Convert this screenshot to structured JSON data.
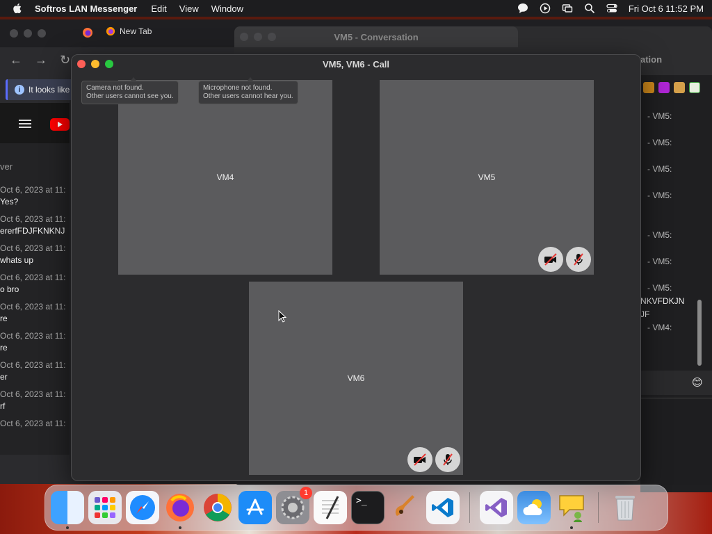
{
  "menubar": {
    "app_name": "Softros LAN Messenger",
    "menus": [
      "Edit",
      "View",
      "Window"
    ],
    "clock": "Fri Oct 6  11:52 PM"
  },
  "browser": {
    "tab_label": "New Tab",
    "info_text": "It looks like",
    "chat_header": "ver",
    "messages": [
      {
        "date": "Oct 6, 2023 at 11:",
        "text": "Yes?"
      },
      {
        "date": "Oct 6, 2023 at 11:",
        "text": "ererfFDJFKNKNJ"
      },
      {
        "date": "Oct 6, 2023 at 11:",
        "text": "whats up"
      },
      {
        "date": "Oct 6, 2023 at 11:",
        "text": "o bro"
      },
      {
        "date": "Oct 6, 2023 at 11:",
        "text": "re"
      },
      {
        "date": "Oct 6, 2023 at 11:",
        "text": "re"
      },
      {
        "date": "Oct 6, 2023 at 11:",
        "text": "er"
      },
      {
        "date": "Oct 6, 2023 at 11:",
        "text": "rf"
      },
      {
        "date": "Oct 6, 2023 at 11:",
        "text": ""
      }
    ]
  },
  "conversation": {
    "title": "VM5 - Conversation",
    "title_right": "ation",
    "log": [
      "- VM5:",
      "- VM5:",
      "- VM5:",
      "- VM5:",
      "- VM5:",
      "- VM5:",
      "- VM5:",
      "NKVFDKJN",
      "JF",
      "- VM4:"
    ],
    "emoji": "😊"
  },
  "call": {
    "title": "VM5, VM6 - Call",
    "camera_notice_line1": "Camera not found.",
    "camera_notice_line2": "Other users cannot see you.",
    "mic_notice_line1": "Microphone not found.",
    "mic_notice_line2": "Other users cannot hear you.",
    "participants": [
      "VM4",
      "VM5",
      "VM6"
    ]
  },
  "dock": {
    "apps": [
      "finder-icon",
      "launchpad-icon",
      "safari-icon",
      "firefox-icon",
      "chrome-icon",
      "app-store-icon",
      "system-settings-icon",
      "textedit-icon",
      "terminal-icon",
      "garageband-icon",
      "vscode-icon",
      "visual-studio-icon",
      "weather-icon",
      "softros-messenger-icon",
      "trash-icon"
    ],
    "settings_badge": "1"
  },
  "colors": {
    "tile_bg": "#5b5b5d",
    "window_bg": "#2c2c2e",
    "close": "#ff5f57",
    "minimize": "#febc2e",
    "zoom": "#28c840"
  }
}
